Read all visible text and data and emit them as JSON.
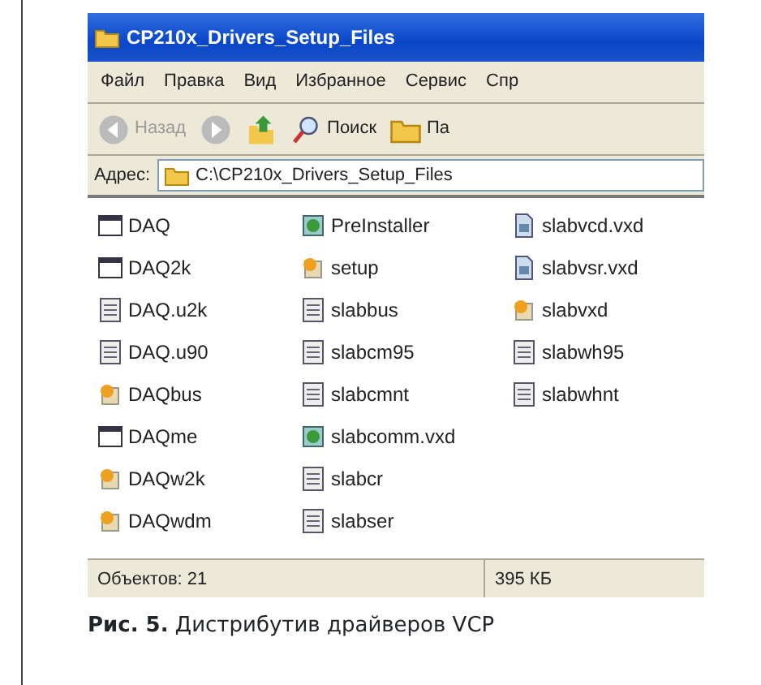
{
  "window": {
    "title": "CP210x_Drivers_Setup_Files"
  },
  "menu": [
    "Файл",
    "Правка",
    "Вид",
    "Избранное",
    "Сервис",
    "Спр"
  ],
  "toolbar": [
    {
      "kind": "back",
      "label": "Назад",
      "disabled": true
    },
    {
      "kind": "forward",
      "disabled": true
    },
    {
      "kind": "up"
    },
    {
      "kind": "search",
      "label": "Поиск"
    },
    {
      "kind": "folders",
      "label": "Па"
    }
  ],
  "address": {
    "label": "Адрес:",
    "value": "C:\\CP210x_Drivers_Setup_Files"
  },
  "files": [
    {
      "name": "DAQ",
      "kind": "window"
    },
    {
      "name": "DAQ2k",
      "kind": "window"
    },
    {
      "name": "DAQ.u2k",
      "kind": "system"
    },
    {
      "name": "DAQ.u90",
      "kind": "system"
    },
    {
      "name": "DAQbus",
      "kind": "setup"
    },
    {
      "name": "DAQme",
      "kind": "window"
    },
    {
      "name": "DAQw2k",
      "kind": "setup"
    },
    {
      "name": "DAQwdm",
      "kind": "setup"
    },
    {
      "name": "PreInstaller",
      "kind": "app"
    },
    {
      "name": "setup",
      "kind": "setup"
    },
    {
      "name": "slabbus",
      "kind": "system"
    },
    {
      "name": "slabcm95",
      "kind": "system"
    },
    {
      "name": "slabcmnt",
      "kind": "system"
    },
    {
      "name": "slabcomm.vxd",
      "kind": "app"
    },
    {
      "name": "slabcr",
      "kind": "system"
    },
    {
      "name": "slabser",
      "kind": "system"
    },
    {
      "name": "slabvcd.vxd",
      "kind": "vxd"
    },
    {
      "name": "slabvsr.vxd",
      "kind": "vxd"
    },
    {
      "name": "slabvxd",
      "kind": "setup"
    },
    {
      "name": "slabwh95",
      "kind": "system"
    },
    {
      "name": "slabwhnt",
      "kind": "system"
    }
  ],
  "status_bar": {
    "objects": "Объектов: 21",
    "size": "395 КБ"
  },
  "caption": "**Рис. 5.** Дистрибутив драйверов VCP"
}
